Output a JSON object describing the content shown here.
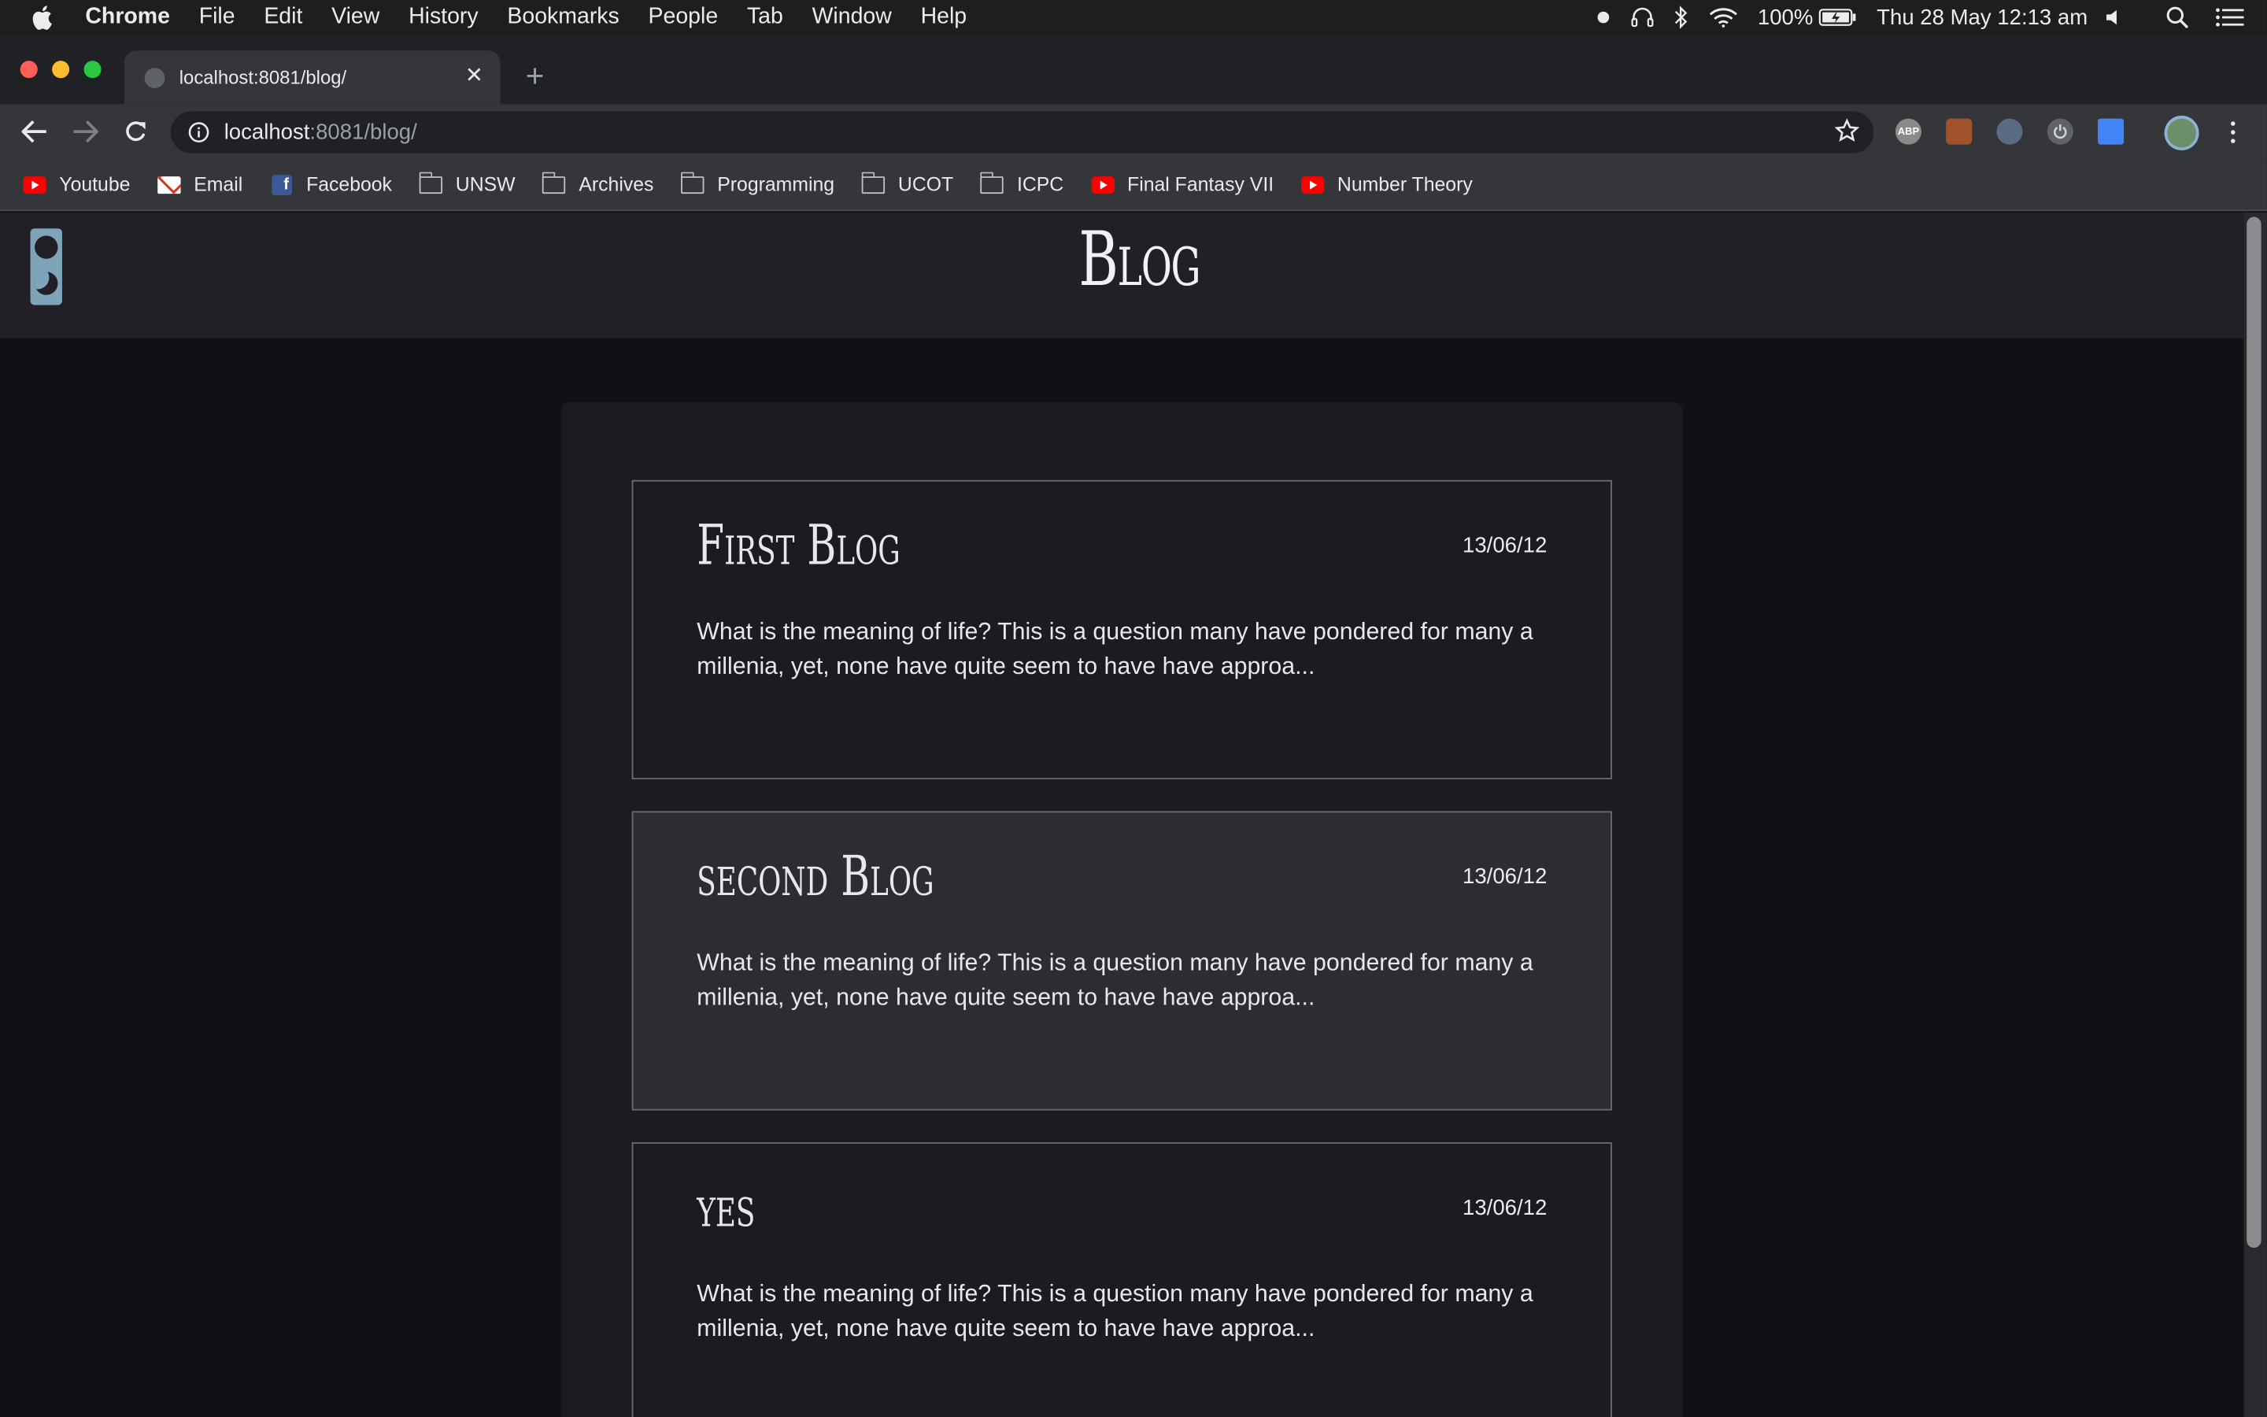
{
  "menubar": {
    "items": [
      "Chrome",
      "File",
      "Edit",
      "View",
      "History",
      "Bookmarks",
      "People",
      "Tab",
      "Window",
      "Help"
    ],
    "battery": "100%",
    "clock": "Thu 28 May  12:13 am"
  },
  "browser": {
    "tab_title": "localhost:8081/blog/",
    "url_host": "localhost",
    "url_rest": ":8081/blog/",
    "extensions": [
      "ABP"
    ],
    "bookmarks": [
      {
        "label": "Youtube",
        "icon": "youtube-icon"
      },
      {
        "label": "Email",
        "icon": "gmail-icon"
      },
      {
        "label": "Facebook",
        "icon": "facebook-icon"
      },
      {
        "label": "UNSW",
        "icon": "folder-icon"
      },
      {
        "label": "Archives",
        "icon": "folder-icon"
      },
      {
        "label": "Programming",
        "icon": "folder-icon"
      },
      {
        "label": "UCOT",
        "icon": "folder-icon"
      },
      {
        "label": "ICPC",
        "icon": "folder-icon"
      },
      {
        "label": "Final Fantasy VII",
        "icon": "youtube-icon"
      },
      {
        "label": "Number Theory",
        "icon": "youtube-icon"
      }
    ]
  },
  "site": {
    "title": "Blog",
    "posts": [
      {
        "title": "First Blog",
        "date": "13/06/12",
        "excerpt": "What is the meaning of life? This is a question many have pondered for many a millenia, yet, none have quite seem to have have approa..."
      },
      {
        "title": "second Blog",
        "date": "13/06/12",
        "excerpt": "What is the meaning of life? This is a question many have pondered for many a millenia, yet, none have quite seem to have have approa..."
      },
      {
        "title": "yes",
        "date": "13/06/12",
        "excerpt": "What is the meaning of life? This is a question many have pondered for many a millenia, yet, none have quite seem to have have approa..."
      }
    ]
  },
  "colors": {
    "header_bg": "#221f26",
    "page_bg": "#111015",
    "card_bg": "#1c1b20",
    "hover_card_bg": "#2e2c33",
    "toggle_accent": "#7da4b8"
  }
}
